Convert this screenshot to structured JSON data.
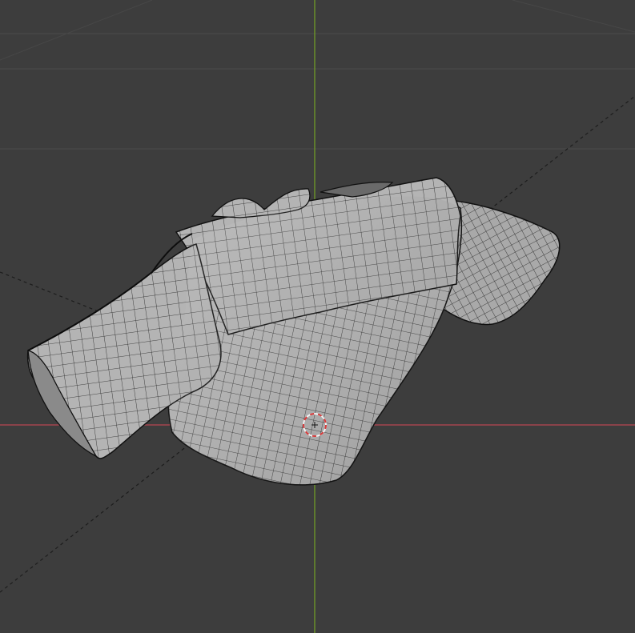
{
  "app": {
    "name": "3D Viewport",
    "mode": "wireframe-overlay"
  },
  "scene": {
    "object": {
      "type": "cloth-mesh",
      "description_hidden": true
    },
    "colors": {
      "background": "#3d3d3d",
      "grid": "#4a4a4a",
      "x_axis": "#a3444f",
      "y_axis": "#6a8f2a",
      "mesh_fill": "#b4b4b4",
      "mesh_wire": "#222222",
      "cursor_red": "#d63a3a",
      "cursor_white": "#f2f2f2"
    },
    "icons": {
      "cursor": "3d-cursor-icon"
    }
  }
}
